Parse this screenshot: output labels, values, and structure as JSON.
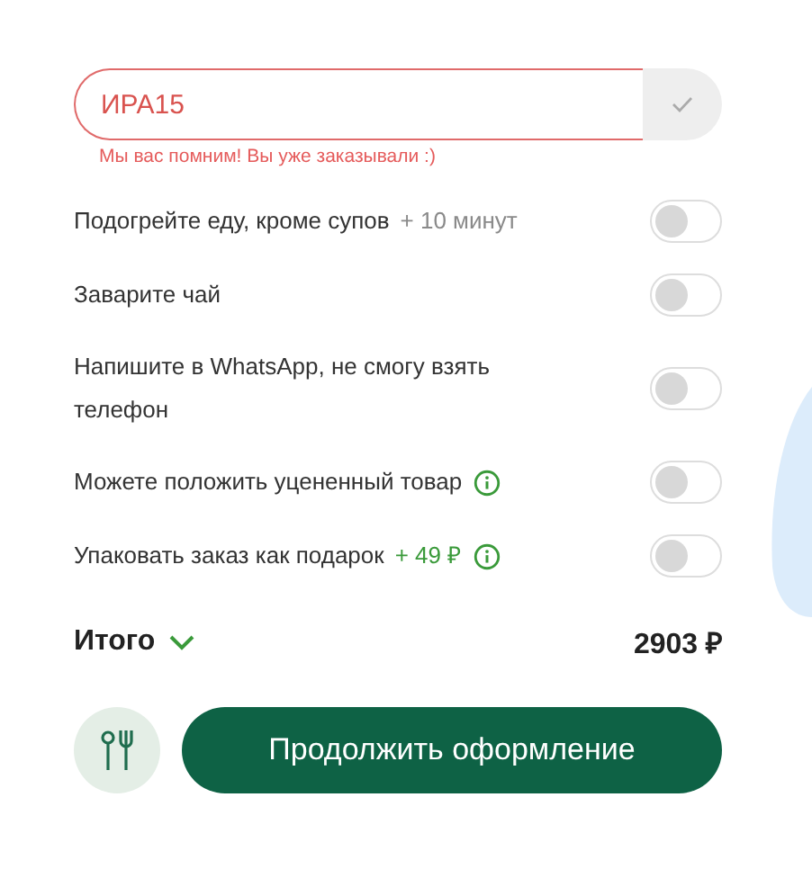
{
  "promo": {
    "value": "ИРА15",
    "error": true,
    "message": "Мы вас помним! Вы уже заказывали :)"
  },
  "options": [
    {
      "label": "Подогрейте еду, кроме супов",
      "note": {
        "text": "+ 10 минут",
        "color": "#8a8a8a"
      },
      "info": false,
      "on": false
    },
    {
      "label": "Заварите чай",
      "info": false,
      "on": false
    },
    {
      "label": "Напишите в WhatsApp, не смогу взять телефон",
      "info": false,
      "on": false
    },
    {
      "label": "Можете положить уцененный товар",
      "info": true,
      "on": false
    },
    {
      "label": "Упаковать заказ как подарок",
      "note": {
        "text": "+ 49 ₽",
        "color": "#3a9a3a"
      },
      "info": true,
      "on": false
    }
  ],
  "total": {
    "label": "Итого",
    "expanded": false,
    "amount": "2903 ₽"
  },
  "submit": "Продолжить оформление"
}
